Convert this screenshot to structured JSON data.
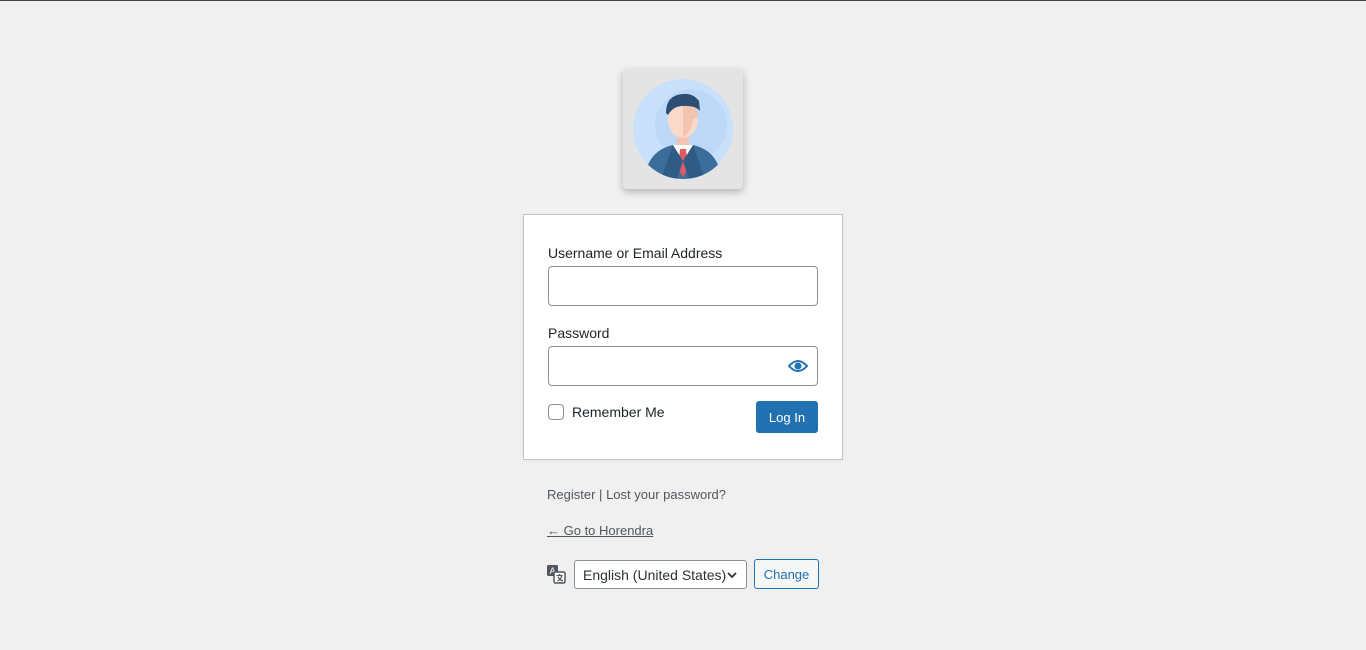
{
  "login": {
    "username_label": "Username or Email Address",
    "username_value": "",
    "password_label": "Password",
    "password_value": "",
    "remember_label": "Remember Me",
    "login_button": "Log In"
  },
  "links": {
    "register": "Register",
    "separator": "|",
    "lost_password": "Lost your password?",
    "back_to_site": "← Go to Horendra"
  },
  "language": {
    "selected": "English (United States)",
    "change_button": "Change"
  },
  "icons": {
    "logo": "user-avatar-icon",
    "password_toggle": "eye-icon",
    "language": "translation-icon",
    "dropdown": "chevron-down-icon"
  },
  "colors": {
    "background": "#f0f0f1",
    "primary": "#2271b1",
    "card": "#ffffff"
  }
}
